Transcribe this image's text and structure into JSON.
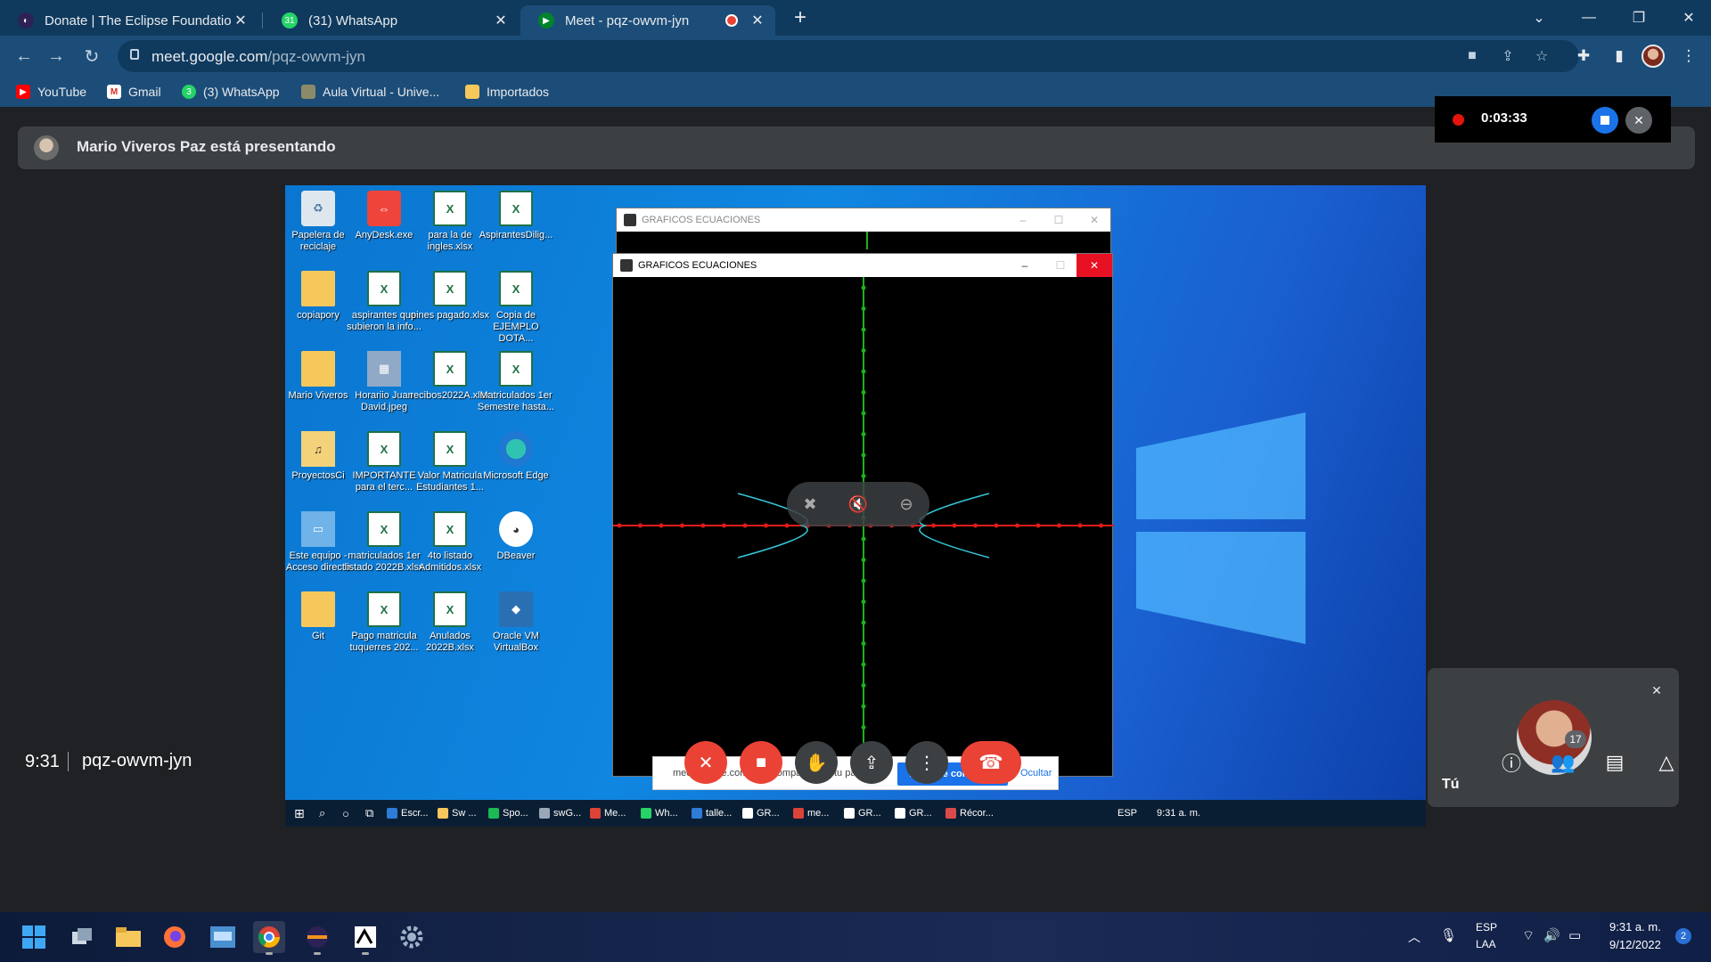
{
  "browser": {
    "tabs": [
      {
        "title": "Donate | The Eclipse Foundation",
        "active": false
      },
      {
        "title": "(31) WhatsApp",
        "active": false
      },
      {
        "title": "Meet - pqz-owvm-jyn",
        "active": true
      }
    ],
    "url_host": "meet.google.com",
    "url_path": "/pqz-owvm-jyn",
    "bookmarks": [
      "YouTube",
      "Gmail",
      "(3) WhatsApp",
      "Aula Virtual - Unive...",
      "Importados"
    ]
  },
  "meet": {
    "presenter_text": "Mario Viveros Paz está presentando",
    "recording_time": "0:03:33",
    "self_name": "Tú",
    "clock": "9:31",
    "meeting_code": "pqz-owvm-jyn",
    "people_count": "17"
  },
  "shared_screen": {
    "desktop_icons": [
      {
        "label": "Papelera de reciclaje",
        "kind": "bin"
      },
      {
        "label": "AnyDesk.exe",
        "kind": "red"
      },
      {
        "label": "para la de ingles.xlsx",
        "kind": "xl"
      },
      {
        "label": "AspirantesDilig...",
        "kind": "xl"
      },
      {
        "label": "copiapory",
        "kind": "folder"
      },
      {
        "label": "aspirantes que subieron la info...",
        "kind": "xl"
      },
      {
        "label": "pines pagado.xlsx",
        "kind": "xl"
      },
      {
        "label": "Copia de EJEMPLO DOTA...",
        "kind": "xl"
      },
      {
        "label": "Mario Viveros",
        "kind": "folder"
      },
      {
        "label": "Horariio Juan David.jpeg",
        "kind": "img"
      },
      {
        "label": "recibos2022A.xlsx",
        "kind": "xl"
      },
      {
        "label": "Matriculados 1er Semestre hasta...",
        "kind": "xl"
      },
      {
        "label": "ProyectosCi",
        "kind": "music"
      },
      {
        "label": "IMPORTANTE para el terc...",
        "kind": "xl"
      },
      {
        "label": "Valor Matricula Estudiantes 1...",
        "kind": "xl"
      },
      {
        "label": "Microsoft Edge",
        "kind": "edge"
      },
      {
        "label": "Este equipo - Acceso directo",
        "kind": "pc"
      },
      {
        "label": "matriculados 1er listado 2022B.xlsx",
        "kind": "xl"
      },
      {
        "label": "4to listado Admitidos.xlsx",
        "kind": "xl"
      },
      {
        "label": "DBeaver",
        "kind": "db"
      },
      {
        "label": "Git",
        "kind": "folder"
      },
      {
        "label": "Pago matricula tuquerres 202...",
        "kind": "xl"
      },
      {
        "label": "Anulados 2022B.xlsx",
        "kind": "xl"
      },
      {
        "label": "Oracle VM VirtualBox",
        "kind": "vbox"
      }
    ],
    "window_title_back": "GRAFICOS ECUACIONES",
    "window_title_front": "GRAFICOS ECUACIONES",
    "share_banner_text": "meet.google.com está compartiendo tu pantalla.",
    "share_stop_button": "Dejar de compartir",
    "share_hide_link": "Ocultar",
    "taskbar_items": [
      "Escr...",
      "Sw ...",
      "Spo...",
      "swG...",
      "Me...",
      "Wh...",
      "talle...",
      "GR...",
      "me...",
      "GR...",
      "GR...",
      "Récor..."
    ],
    "tray_lang": "ESP",
    "tray_time": "9:31 a. m."
  },
  "taskbar": {
    "lang_top": "ESP",
    "lang_bottom": "LAA",
    "time": "9:31 a. m.",
    "date": "9/12/2022",
    "notification_count": "2"
  },
  "colors": {
    "tab_strip": "#0f3a5e",
    "toolbar": "#1c4d78",
    "meet_bg": "#202124",
    "hangup": "#ea4335",
    "accent_blue": "#1a73e8"
  }
}
